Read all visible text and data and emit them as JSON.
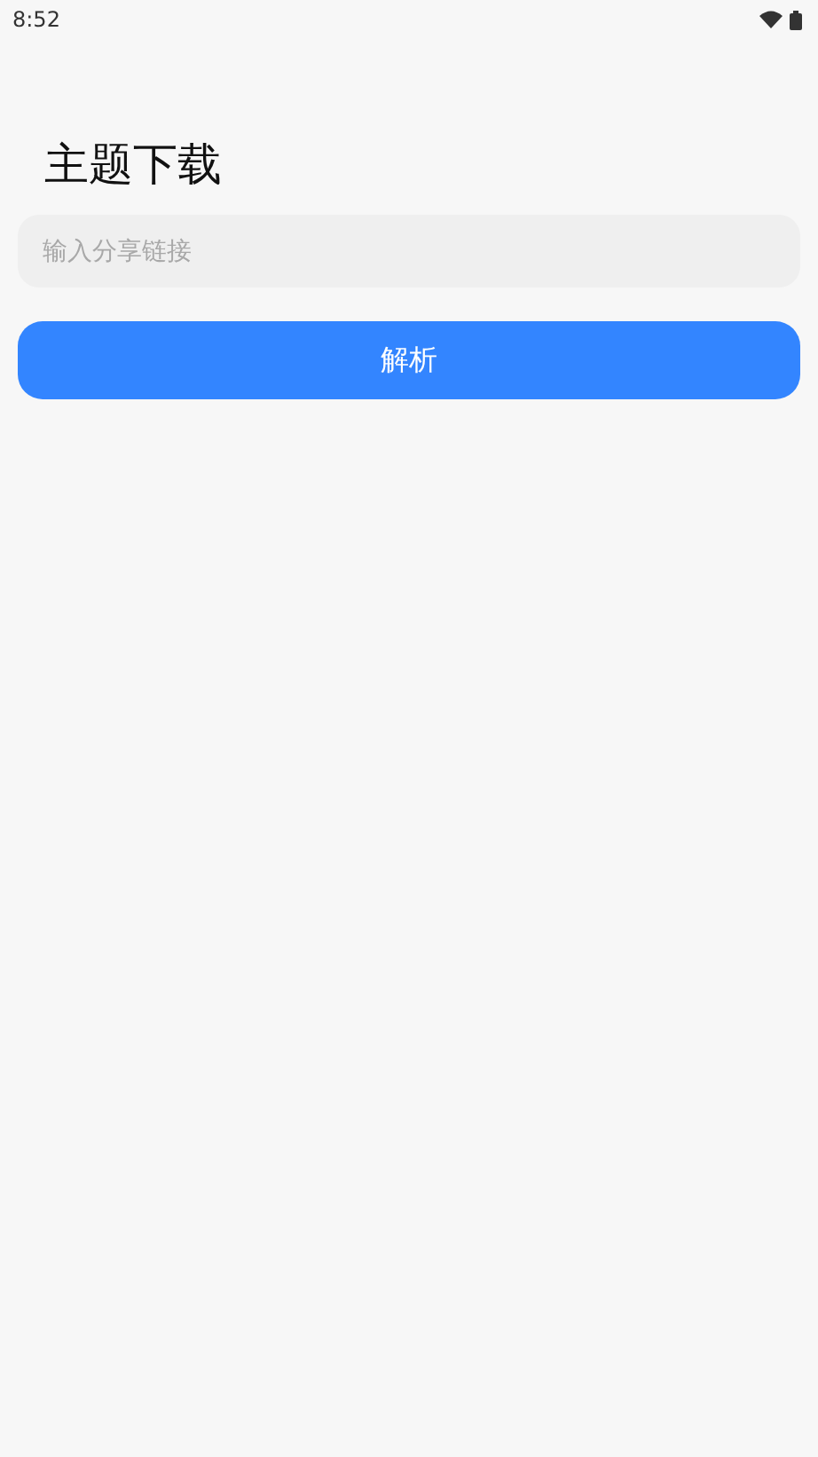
{
  "status_bar": {
    "time": "8:52"
  },
  "title": "主题下载",
  "link_field": {
    "placeholder": "输入分享链接"
  },
  "parse_button": {
    "label": "解析"
  }
}
